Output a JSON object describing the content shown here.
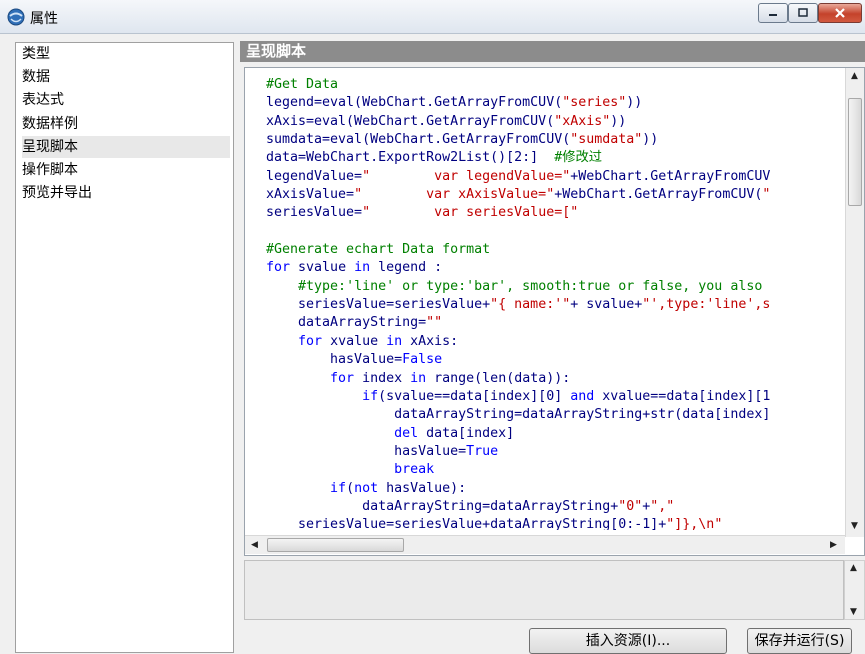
{
  "window": {
    "title": "属性",
    "icon": "app-globe-icon"
  },
  "sidebar": {
    "items": [
      {
        "label": "类型",
        "selected": false
      },
      {
        "label": "数据",
        "selected": false
      },
      {
        "label": "表达式",
        "selected": false
      },
      {
        "label": "数据样例",
        "selected": false
      },
      {
        "label": "呈现脚本",
        "selected": true
      },
      {
        "label": "操作脚本",
        "selected": false
      },
      {
        "label": "预览并导出",
        "selected": false
      }
    ]
  },
  "panel": {
    "title": "呈现脚本"
  },
  "editor": {
    "lines": [
      "#Get Data",
      "legend=eval(WebChart.GetArrayFromCUV(\"series\"))",
      "xAxis=eval(WebChart.GetArrayFromCUV(\"xAxis\"))",
      "sumdata=eval(WebChart.GetArrayFromCUV(\"sumdata\"))",
      "data=WebChart.ExportRow2List()[2:]  #修改过",
      "legendValue=\"        var legendValue=\"+WebChart.GetArrayFromCUV",
      "xAxisValue=\"        var xAxisValue=\"+WebChart.GetArrayFromCUV(\"",
      "seriesValue=\"        var seriesValue=[\"",
      "",
      "#Generate echart Data format",
      "for svalue in legend :",
      "    #type:'line' or type:'bar', smooth:true or false, you also",
      "    seriesValue=seriesValue+\"{ name:'\"+ svalue+\"',type:'line',s",
      "    dataArrayString=\"\"",
      "    for xvalue in xAxis:",
      "        hasValue=False",
      "        for index in range(len(data)):",
      "            if(svalue==data[index][0] and xvalue==data[index][1",
      "                dataArrayString=dataArrayString+str(data[index]",
      "                del data[index]",
      "                hasValue=True",
      "                break",
      "        if(not hasValue):",
      "            dataArrayString=dataArrayString+\"0\"+\",\"",
      "    seriesValue=seriesValue+dataArrayString[0:-1]+\"]},\\n\""
    ]
  },
  "buttons": {
    "insert_resource": "插入资源(I)...",
    "save_run": "保存并运行(S)"
  },
  "colors": {
    "code_default": "#000080",
    "keyword": "#0000ff",
    "string": "#c00000",
    "comment": "#008000",
    "panel_header": "#8c8c8c"
  }
}
